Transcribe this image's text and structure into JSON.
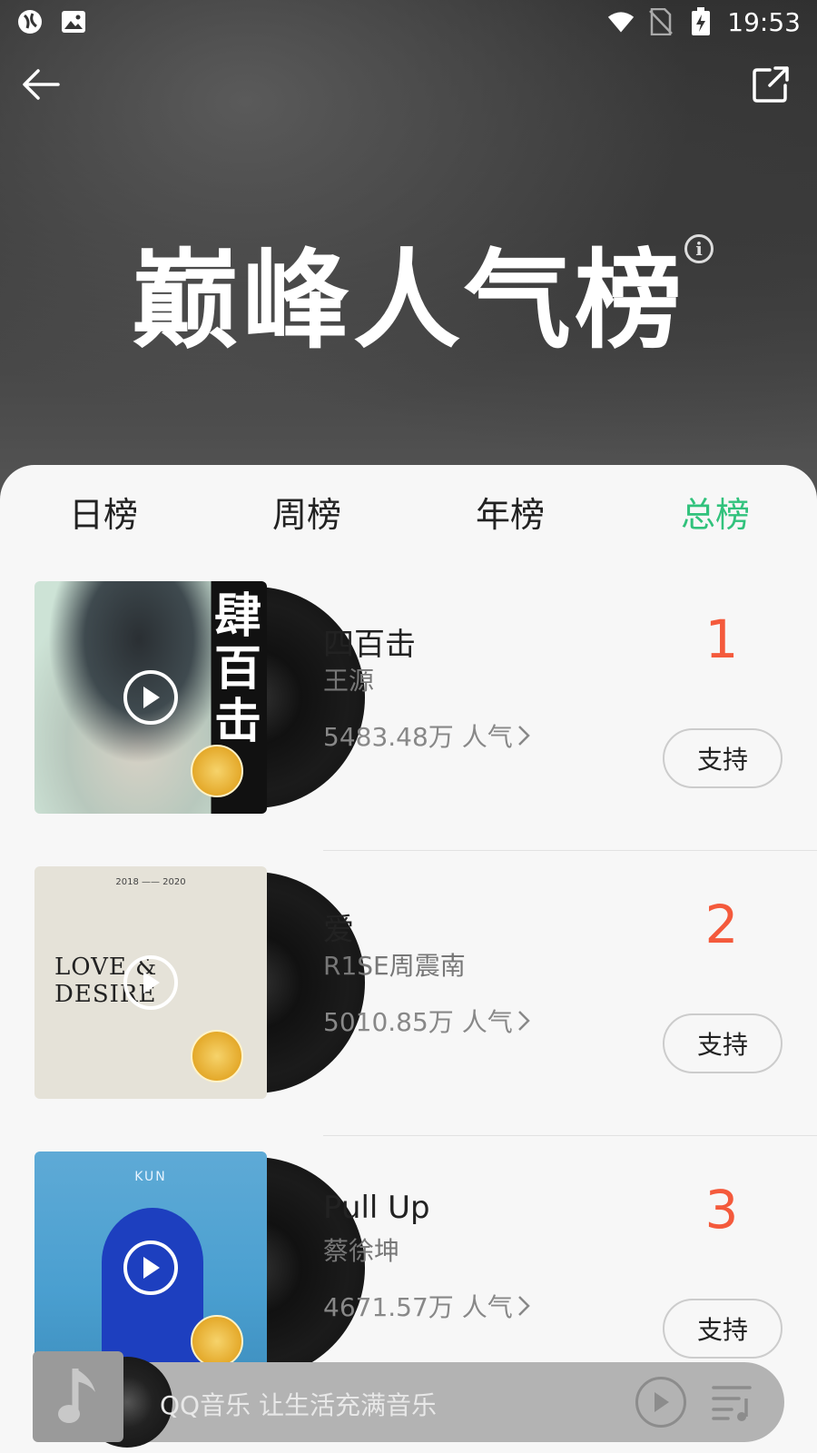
{
  "status_bar": {
    "time": "19:53"
  },
  "header": {
    "title": "巅峰人气榜"
  },
  "tabs": [
    {
      "label": "日榜"
    },
    {
      "label": "周榜"
    },
    {
      "label": "年榜"
    },
    {
      "label": "总榜"
    }
  ],
  "ranking": [
    {
      "rank": "1",
      "title": "四百击",
      "artist": "王源",
      "popularity": "5483.48万 人气",
      "support_label": "支持",
      "cover_text": "肆百击"
    },
    {
      "rank": "2",
      "title": "爱",
      "artist": "R1SE周震南",
      "popularity": "5010.85万 人气",
      "support_label": "支持",
      "cover_top": "2018 —— 2020",
      "cover_text": "LOVE & DESIRE"
    },
    {
      "rank": "3",
      "title": "Pull Up",
      "artist": "蔡徐坤",
      "popularity": "4671.57万 人气",
      "support_label": "支持",
      "cover_top": "KUN"
    }
  ],
  "mini_player": {
    "text": "QQ音乐 让生活充满音乐"
  },
  "colors": {
    "accent": "#31c27c",
    "rank": "#f45a3c"
  }
}
